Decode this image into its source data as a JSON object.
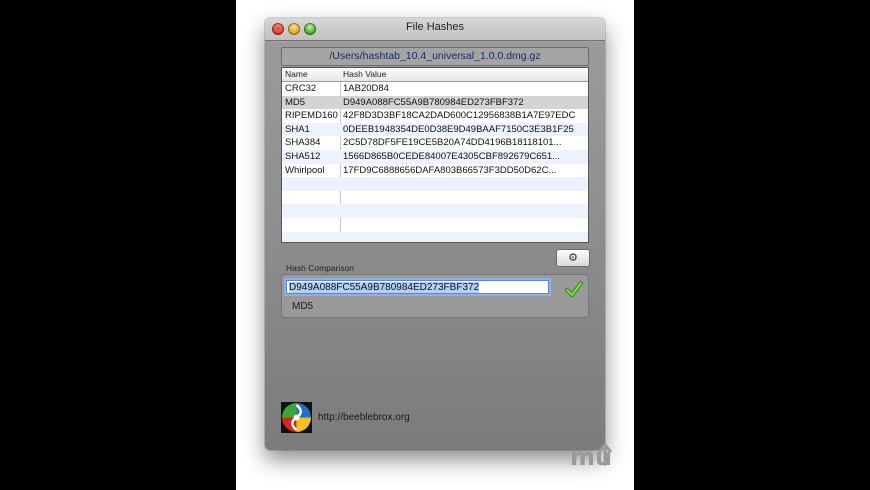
{
  "window": {
    "title": "File Hashes",
    "path": "/Users/hashtab_10.4_universal_1.0.0.dmg.gz"
  },
  "table": {
    "columns": [
      "Name",
      "Hash Value"
    ],
    "rows": [
      {
        "name": "CRC32",
        "value": "1AB20D84"
      },
      {
        "name": "MD5",
        "value": "D949A088FC55A9B780984ED273FBF372"
      },
      {
        "name": "RIPEMD160",
        "value": "42F8D3D3BF18CA2DAD600C12956838B1A7E97EDC"
      },
      {
        "name": "SHA1",
        "value": "0DEEB1948354DE0D38E9D49BAAF7150C3E3B1F25"
      },
      {
        "name": "SHA384",
        "value": "2C5D78DF5FE19CE5B20A74DD4196B18118101..."
      },
      {
        "name": "SHA512",
        "value": "1566D865B0CEDE84007E4305CBF892679C651..."
      },
      {
        "name": "Whirlpool",
        "value": "17FD9C6888656DAFA803B66573F3DD50D62C..."
      }
    ],
    "selected_row": "MD5"
  },
  "settings_button": {
    "icon": "gear-icon"
  },
  "comparison": {
    "label": "Hash Comparison",
    "input_value": "D949A088FC55A9B780984ED273FBF372",
    "match_algorithm": "MD5",
    "match_icon": "checkmark-icon",
    "match_color": "#3fbf1f"
  },
  "footer": {
    "url": "http://beeblebrox.org",
    "logo_icon": "beeblebrox-logo"
  },
  "watermark": {
    "icon": "mu-logo-watermark"
  }
}
